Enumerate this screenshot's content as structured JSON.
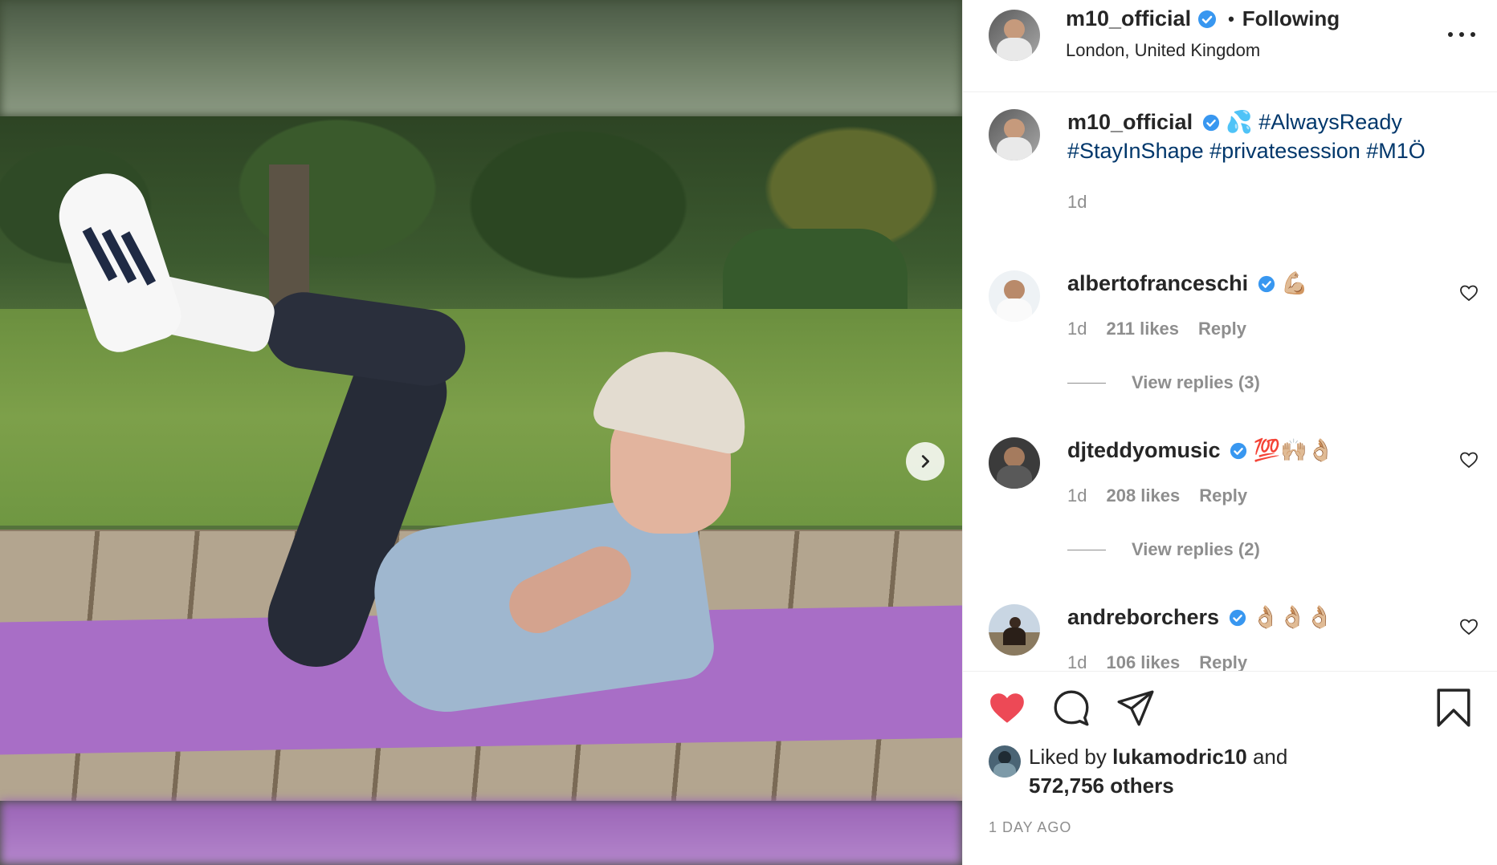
{
  "post": {
    "author": {
      "username": "m10_official",
      "verified": true,
      "follow_status": "Following",
      "location": "London, United Kingdom"
    },
    "caption": {
      "username": "m10_official",
      "emoji": "💦",
      "hashtags": [
        "#AlwaysReady",
        "#StayInShape",
        "#privatesession",
        "#M1Ö"
      ],
      "time": "1d"
    },
    "comments": [
      {
        "username": "albertofranceschi",
        "verified": true,
        "text": "💪🏼",
        "time": "1d",
        "likes": "211 likes",
        "reply_label": "Reply",
        "view_replies": "View replies (3)"
      },
      {
        "username": "djteddyomusic",
        "verified": true,
        "text": "💯🙌🏼👌🏼",
        "time": "1d",
        "likes": "208 likes",
        "reply_label": "Reply",
        "view_replies": "View replies (2)"
      },
      {
        "username": "andreborchers",
        "verified": true,
        "text": "👌🏼👌🏼👌🏼",
        "time": "1d",
        "likes": "106 likes",
        "reply_label": "Reply"
      }
    ],
    "likes": {
      "prefix": "Liked by",
      "user": "lukamodric10",
      "connector": "and",
      "others": "572,756 others"
    },
    "posted_ago": "1 DAY AGO",
    "liked_by_viewer": true,
    "colors": {
      "heart": "#ed4956",
      "verified": "#3897f0",
      "hashtag": "#00376b",
      "muted": "#8e8e8e"
    },
    "icons": [
      "next-arrow-icon",
      "more-options-icon",
      "heart-icon",
      "comment-icon",
      "share-icon",
      "bookmark-icon",
      "verified-icon"
    ]
  }
}
